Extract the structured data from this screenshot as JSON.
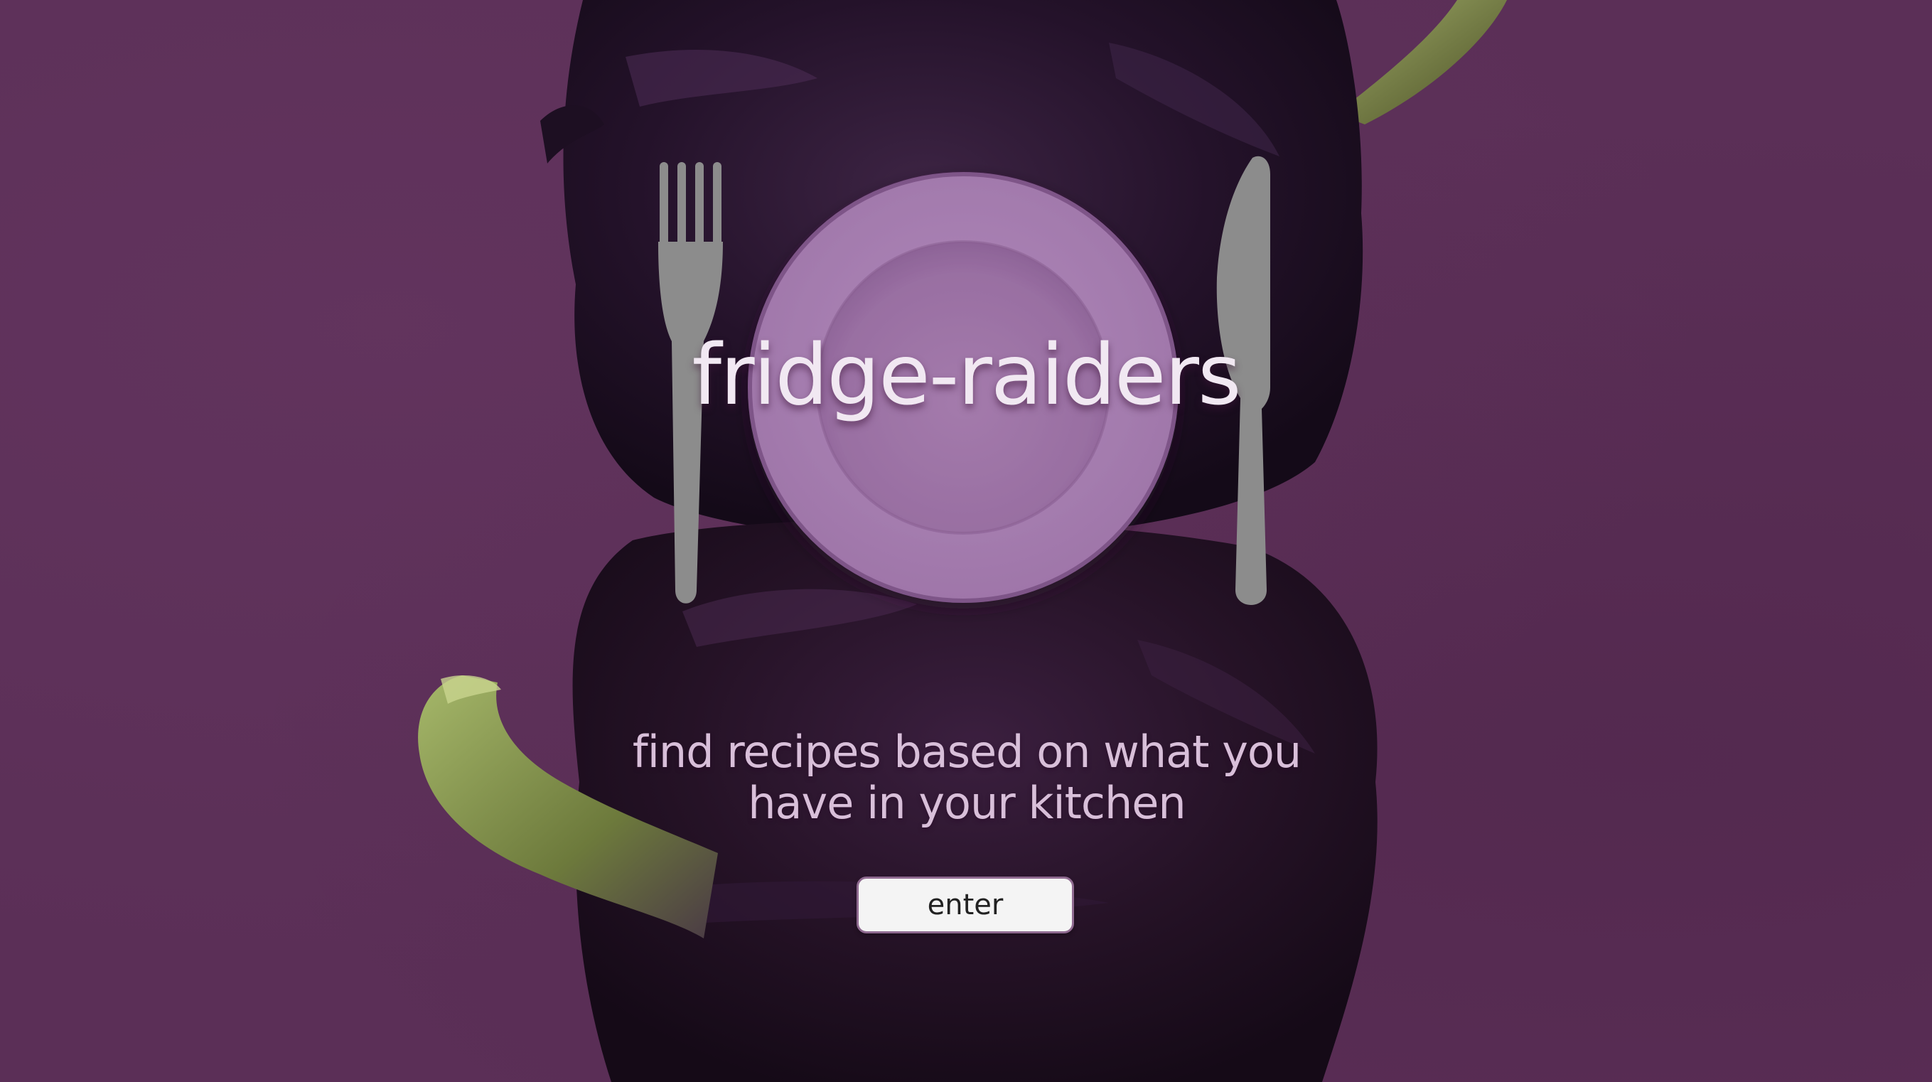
{
  "app": {
    "title": "fridge-raiders",
    "tagline": "find recipes based on what you have in your kitchen",
    "enter_label": "enter"
  },
  "colors": {
    "background": "#5b2f57",
    "plate_outer": "#a57fb0",
    "plate_inner": "#9d75a8",
    "cutlery": "#8c8c8c",
    "title_text": "#f1e8f2",
    "tagline_text": "#d8bfd9",
    "button_bg": "#f4f4f4",
    "button_border": "#8f6a90"
  },
  "icons": {
    "fork": "fork-icon",
    "knife": "knife-icon",
    "plate": "plate-icon"
  }
}
